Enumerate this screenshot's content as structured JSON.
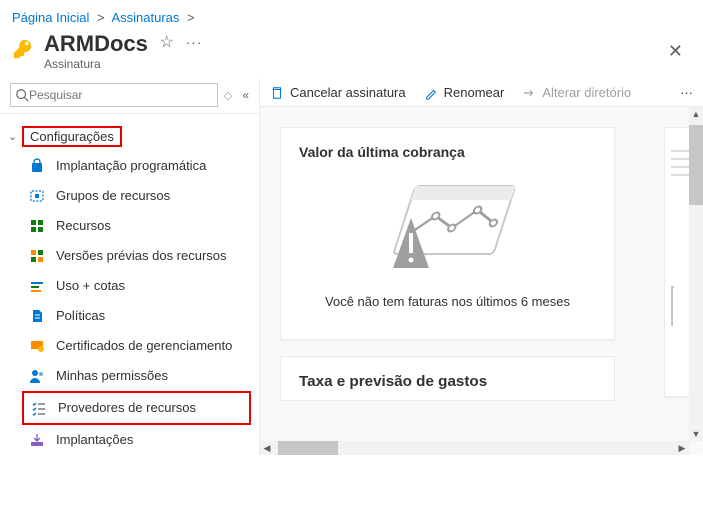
{
  "breadcrumb": {
    "home": "Página Inicial",
    "subscriptions": "Assinaturas"
  },
  "header": {
    "title": "ARMDocs",
    "subtitle": "Assinatura"
  },
  "sidebar": {
    "search_placeholder": "Pesquisar",
    "section_label": "Configurações",
    "items": [
      {
        "label": "Implantação programática"
      },
      {
        "label": "Grupos de recursos"
      },
      {
        "label": "Recursos"
      },
      {
        "label": "Versões prévias dos recursos"
      },
      {
        "label": "Uso + cotas"
      },
      {
        "label": "Políticas"
      },
      {
        "label": "Certificados de gerenciamento"
      },
      {
        "label": "Minhas permissões"
      },
      {
        "label": "Provedores de recursos"
      },
      {
        "label": "Implantações"
      }
    ]
  },
  "toolbar": {
    "cancel": "Cancelar assinatura",
    "rename": "Renomear",
    "change_dir": "Alterar diretório"
  },
  "cards": {
    "billing_title": "Valor da última cobrança",
    "billing_empty": "Você não tem faturas nos últimos 6 meses",
    "forecast_title": "Taxa e previsão de gastos"
  }
}
